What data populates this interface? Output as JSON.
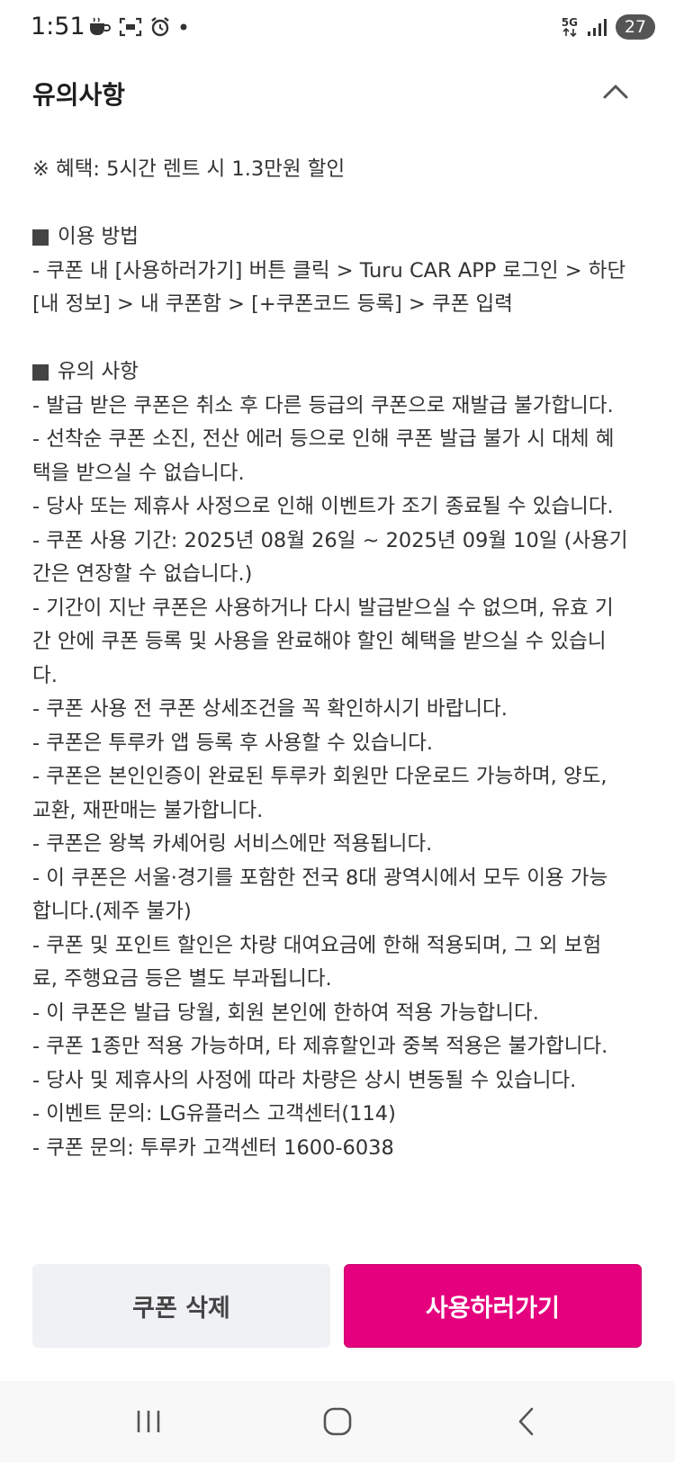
{
  "status_bar": {
    "time": "1:51",
    "network": "5G",
    "battery": "27",
    "icons": [
      "cup-icon",
      "screenshot-icon",
      "alarm-icon",
      "dot-icon",
      "network-5g-icon",
      "signal-icon",
      "battery-icon"
    ]
  },
  "header": {
    "title": "유의사항",
    "collapse_icon": "chevron-up-icon"
  },
  "content": {
    "benefit": "※ 혜택: 5시간 렌트 시 1.3만원 할인",
    "usage": {
      "heading": "이용 방법",
      "lines": [
        "- 쿠폰 내 [사용하러가기] 버튼 클릭 > Turu CAR APP 로그인 > 하단",
        "[내 정보] > 내 쿠폰함 > [+쿠폰코드 등록] > 쿠폰 입력"
      ]
    },
    "notes": {
      "heading": "유의 사항",
      "lines": [
        "- 발급 받은 쿠폰은 취소 후 다른 등급의 쿠폰으로 재발급 불가합니다.",
        "- 선착순 쿠폰 소진, 전산 에러 등으로 인해 쿠폰 발급 불가 시 대체 혜",
        "택을 받으실 수 없습니다.",
        "- 당사 또는 제휴사 사정으로 인해 이벤트가 조기 종료될 수 있습니다.",
        "- 쿠폰 사용 기간: 2025년 08월 26일 ~ 2025년 09월 10일 (사용기",
        "간은 연장할 수 없습니다.)",
        "- 기간이 지난 쿠폰은 사용하거나 다시 발급받으실 수 없으며, 유효 기",
        "간 안에 쿠폰 등록 및 사용을 완료해야 할인 혜택을 받으실 수 있습니",
        "다.",
        "- 쿠폰 사용 전 쿠폰 상세조건을 꼭 확인하시기 바랍니다.",
        "- 쿠폰은 투루카 앱 등록 후 사용할 수 있습니다.",
        "- 쿠폰은 본인인증이 완료된 투루카 회원만 다운로드 가능하며, 양도,",
        "교환, 재판매는 불가합니다.",
        "- 쿠폰은 왕복 카셰어링 서비스에만 적용됩니다.",
        "- 이 쿠폰은 서울·경기를 포함한 전국 8대 광역시에서 모두 이용 가능",
        "합니다.(제주 불가)",
        "- 쿠폰 및 포인트 할인은 차량 대여요금에 한해 적용되며, 그 외 보험",
        "료, 주행요금 등은 별도 부과됩니다.",
        "- 이 쿠폰은 발급 당월, 회원 본인에 한하여 적용 가능합니다.",
        "- 쿠폰 1종만 적용 가능하며, 타 제휴할인과 중복 적용은 불가합니다.",
        "- 당사 및 제휴사의 사정에 따라 차량은 상시 변동될 수 있습니다.",
        "- 이벤트 문의: LG유플러스 고객센터(114)",
        "- 쿠폰 문의: 투루카 고객센터 1600-6038"
      ]
    }
  },
  "buttons": {
    "delete_label": "쿠폰 삭제",
    "use_label": "사용하러가기"
  },
  "colors": {
    "accent": "#e5007e",
    "secondary_button": "#f0f1f4"
  },
  "nav_bar": {
    "icons": [
      "recents-icon",
      "home-icon",
      "back-icon"
    ]
  }
}
